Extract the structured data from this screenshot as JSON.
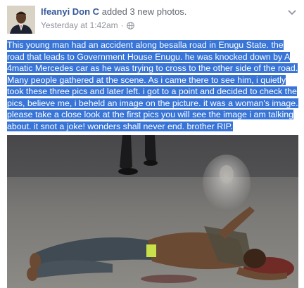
{
  "header": {
    "author": "Ifeanyi Don C",
    "action": "added 3 new photos.",
    "timestamp": "Yesterday at 1:42am",
    "separator": "·",
    "privacy_icon": "globe-icon",
    "menu_icon": "chevron-down-icon"
  },
  "post": {
    "caption": "This young man had an accident along besalla road in Enugu State. the road that leads to Government House Enugu. he was knocked down by A 4matic Mercedes car as he was trying to cross to the other side of the road. Many people gathered at the scene. As i came there to see him, i quietly took these three pics and later left. i got to a point and decided to check the pics, believe me, i beheld an image on the picture. it was a woman's image. please take a close look at the first pics you will see the image i am talking about. it snot a joke! wonders shall never end. brother RIP."
  },
  "colors": {
    "link": "#365899",
    "meta": "#90949c",
    "selection": "#3875d7"
  }
}
